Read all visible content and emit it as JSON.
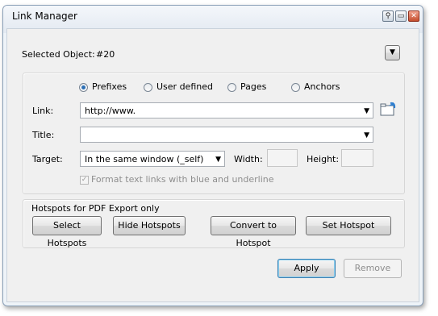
{
  "window": {
    "title": "Link Manager"
  },
  "selected": {
    "label": "Selected Object:",
    "value": "#20"
  },
  "link_type": {
    "options": [
      "Prefixes",
      "User defined",
      "Pages",
      "Anchors"
    ],
    "selected": "Prefixes"
  },
  "form": {
    "link_label": "Link:",
    "link_value": "http://www.",
    "title_label": "Title:",
    "title_value": "",
    "target_label": "Target:",
    "target_value": "In the same window (_self)",
    "width_label": "Width:",
    "width_value": "",
    "height_label": "Height:",
    "height_value": "",
    "format_checkbox": "Format text links with blue and underline"
  },
  "hotspots": {
    "group_label": "Hotspots for PDF Export only",
    "select": "Select Hotspots",
    "hide": "Hide Hotspots",
    "convert": "Convert to Hotspot",
    "set": "Set Hotspot"
  },
  "actions": {
    "apply": "Apply",
    "remove": "Remove"
  }
}
